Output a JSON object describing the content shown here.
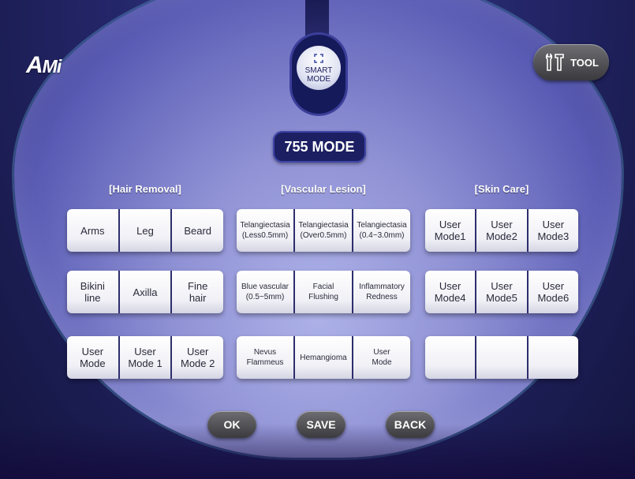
{
  "logo": {
    "main": "A",
    "sub": "Mi"
  },
  "tool": {
    "label": "TOOL",
    "icon": "tools-icon"
  },
  "smart_mode": {
    "label": "SMART\nMODE",
    "icon": "smart-mode-icon"
  },
  "mode_title": "755 MODE",
  "sections": {
    "hair_removal": {
      "title": "[Hair Removal]",
      "rows": [
        [
          "Arms",
          "Leg",
          "Beard"
        ],
        [
          "Bikini\nline",
          "Axilla",
          "Fine\nhair"
        ],
        [
          "User\nMode",
          "User\nMode 1",
          "User\nMode 2"
        ]
      ]
    },
    "vascular_lesion": {
      "title": "[Vascular Lesion]",
      "rows": [
        [
          "Telangiectasia\n(Less0.5mm)",
          "Telangiectasia\n(Over0.5mm)",
          "Telangiectasia\n(0.4~3.0mm)"
        ],
        [
          "Blue vascular\n(0.5~5mm)",
          "Facial\nFlushing",
          "Inflammatory\nRedness"
        ],
        [
          "Nevus\nFlammeus",
          "Hemangioma",
          "User\nMode"
        ]
      ]
    },
    "skin_care": {
      "title": "[Skin Care]",
      "rows": [
        [
          "User\nMode1",
          "User\nMode2",
          "User\nMode3"
        ],
        [
          "User\nMode4",
          "User\nMode5",
          "User\nMode6"
        ],
        [
          "",
          "",
          ""
        ]
      ]
    }
  },
  "actions": {
    "ok": "OK",
    "save": "SAVE",
    "back": "BACK"
  }
}
